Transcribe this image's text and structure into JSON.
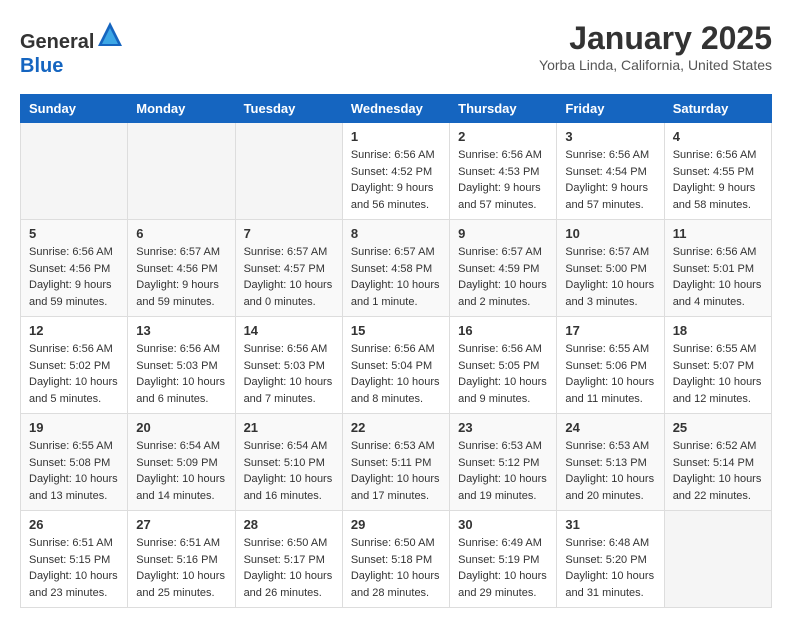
{
  "header": {
    "logo_line1": "General",
    "logo_line2": "Blue",
    "month_title": "January 2025",
    "location": "Yorba Linda, California, United States"
  },
  "weekdays": [
    "Sunday",
    "Monday",
    "Tuesday",
    "Wednesday",
    "Thursday",
    "Friday",
    "Saturday"
  ],
  "weeks": [
    [
      {
        "day": "",
        "info": ""
      },
      {
        "day": "",
        "info": ""
      },
      {
        "day": "",
        "info": ""
      },
      {
        "day": "1",
        "info": "Sunrise: 6:56 AM\nSunset: 4:52 PM\nDaylight: 9 hours\nand 56 minutes."
      },
      {
        "day": "2",
        "info": "Sunrise: 6:56 AM\nSunset: 4:53 PM\nDaylight: 9 hours\nand 57 minutes."
      },
      {
        "day": "3",
        "info": "Sunrise: 6:56 AM\nSunset: 4:54 PM\nDaylight: 9 hours\nand 57 minutes."
      },
      {
        "day": "4",
        "info": "Sunrise: 6:56 AM\nSunset: 4:55 PM\nDaylight: 9 hours\nand 58 minutes."
      }
    ],
    [
      {
        "day": "5",
        "info": "Sunrise: 6:56 AM\nSunset: 4:56 PM\nDaylight: 9 hours\nand 59 minutes."
      },
      {
        "day": "6",
        "info": "Sunrise: 6:57 AM\nSunset: 4:56 PM\nDaylight: 9 hours\nand 59 minutes."
      },
      {
        "day": "7",
        "info": "Sunrise: 6:57 AM\nSunset: 4:57 PM\nDaylight: 10 hours\nand 0 minutes."
      },
      {
        "day": "8",
        "info": "Sunrise: 6:57 AM\nSunset: 4:58 PM\nDaylight: 10 hours\nand 1 minute."
      },
      {
        "day": "9",
        "info": "Sunrise: 6:57 AM\nSunset: 4:59 PM\nDaylight: 10 hours\nand 2 minutes."
      },
      {
        "day": "10",
        "info": "Sunrise: 6:57 AM\nSunset: 5:00 PM\nDaylight: 10 hours\nand 3 minutes."
      },
      {
        "day": "11",
        "info": "Sunrise: 6:56 AM\nSunset: 5:01 PM\nDaylight: 10 hours\nand 4 minutes."
      }
    ],
    [
      {
        "day": "12",
        "info": "Sunrise: 6:56 AM\nSunset: 5:02 PM\nDaylight: 10 hours\nand 5 minutes."
      },
      {
        "day": "13",
        "info": "Sunrise: 6:56 AM\nSunset: 5:03 PM\nDaylight: 10 hours\nand 6 minutes."
      },
      {
        "day": "14",
        "info": "Sunrise: 6:56 AM\nSunset: 5:03 PM\nDaylight: 10 hours\nand 7 minutes."
      },
      {
        "day": "15",
        "info": "Sunrise: 6:56 AM\nSunset: 5:04 PM\nDaylight: 10 hours\nand 8 minutes."
      },
      {
        "day": "16",
        "info": "Sunrise: 6:56 AM\nSunset: 5:05 PM\nDaylight: 10 hours\nand 9 minutes."
      },
      {
        "day": "17",
        "info": "Sunrise: 6:55 AM\nSunset: 5:06 PM\nDaylight: 10 hours\nand 11 minutes."
      },
      {
        "day": "18",
        "info": "Sunrise: 6:55 AM\nSunset: 5:07 PM\nDaylight: 10 hours\nand 12 minutes."
      }
    ],
    [
      {
        "day": "19",
        "info": "Sunrise: 6:55 AM\nSunset: 5:08 PM\nDaylight: 10 hours\nand 13 minutes."
      },
      {
        "day": "20",
        "info": "Sunrise: 6:54 AM\nSunset: 5:09 PM\nDaylight: 10 hours\nand 14 minutes."
      },
      {
        "day": "21",
        "info": "Sunrise: 6:54 AM\nSunset: 5:10 PM\nDaylight: 10 hours\nand 16 minutes."
      },
      {
        "day": "22",
        "info": "Sunrise: 6:53 AM\nSunset: 5:11 PM\nDaylight: 10 hours\nand 17 minutes."
      },
      {
        "day": "23",
        "info": "Sunrise: 6:53 AM\nSunset: 5:12 PM\nDaylight: 10 hours\nand 19 minutes."
      },
      {
        "day": "24",
        "info": "Sunrise: 6:53 AM\nSunset: 5:13 PM\nDaylight: 10 hours\nand 20 minutes."
      },
      {
        "day": "25",
        "info": "Sunrise: 6:52 AM\nSunset: 5:14 PM\nDaylight: 10 hours\nand 22 minutes."
      }
    ],
    [
      {
        "day": "26",
        "info": "Sunrise: 6:51 AM\nSunset: 5:15 PM\nDaylight: 10 hours\nand 23 minutes."
      },
      {
        "day": "27",
        "info": "Sunrise: 6:51 AM\nSunset: 5:16 PM\nDaylight: 10 hours\nand 25 minutes."
      },
      {
        "day": "28",
        "info": "Sunrise: 6:50 AM\nSunset: 5:17 PM\nDaylight: 10 hours\nand 26 minutes."
      },
      {
        "day": "29",
        "info": "Sunrise: 6:50 AM\nSunset: 5:18 PM\nDaylight: 10 hours\nand 28 minutes."
      },
      {
        "day": "30",
        "info": "Sunrise: 6:49 AM\nSunset: 5:19 PM\nDaylight: 10 hours\nand 29 minutes."
      },
      {
        "day": "31",
        "info": "Sunrise: 6:48 AM\nSunset: 5:20 PM\nDaylight: 10 hours\nand 31 minutes."
      },
      {
        "day": "",
        "info": ""
      }
    ]
  ]
}
